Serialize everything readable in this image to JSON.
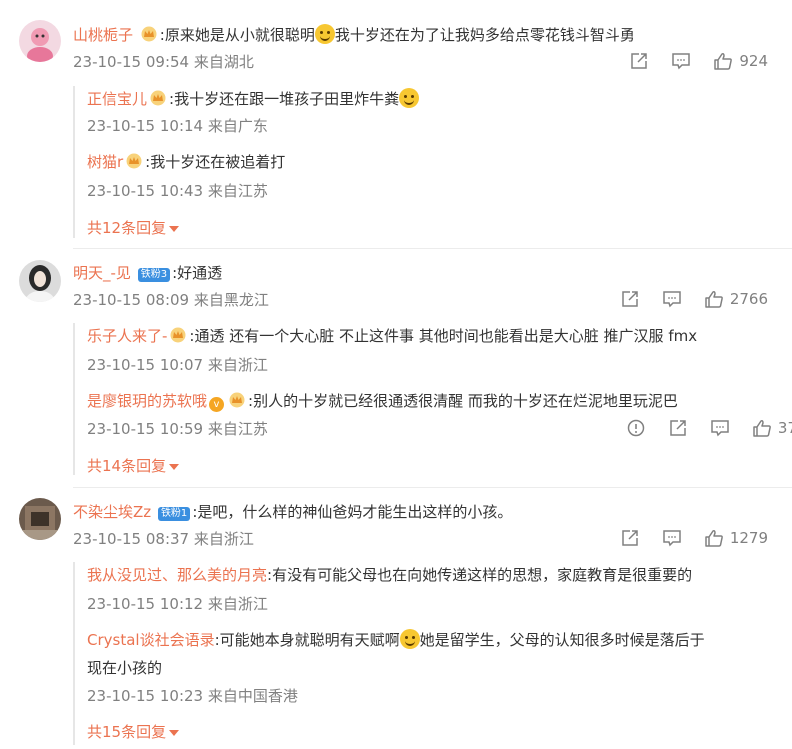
{
  "comments": [
    {
      "user": "山桃栀子",
      "text_a": ":原来她是从小就很聪明",
      "text_b": "我十岁还在为了让我妈多给点零花钱斗智斗勇",
      "time": "23-10-15 09:54 来自湖北",
      "likes": "924",
      "replies": [
        {
          "user": "正信宝儿",
          "text": ":我十岁还在跟一堆孩子田里炸牛粪",
          "time": "23-10-15 10:14 来自广东"
        },
        {
          "user": "树猫r",
          "text": ":我十岁还在被追着打",
          "time": "23-10-15 10:43 来自江苏"
        }
      ],
      "more": "共12条回复"
    },
    {
      "user": "明天_-见",
      "badge": "铁粉3",
      "text_a": ":好通透",
      "time": "23-10-15 08:09 来自黑龙江",
      "likes": "2766",
      "replies": [
        {
          "user": "乐子人来了-",
          "text": ":通透 还有一个大心脏  不止这件事 其他时间也能看出是大心脏 推广汉服  fmx",
          "time": "23-10-15 10:07 来自浙江"
        },
        {
          "user": "是廖银玥的苏软哦",
          "text": ":别人的十岁就已经很通透很清醒 而我的十岁还在烂泥地里玩泥巴",
          "time": "23-10-15 10:59 来自江苏",
          "likes": "37"
        }
      ],
      "more": "共14条回复"
    },
    {
      "user": "不染尘埃Zz",
      "badge": "铁粉1",
      "text_a": ":是吧，什么样的神仙爸妈才能生出这样的小孩。",
      "time": "23-10-15 08:37 来自浙江",
      "likes": "1279",
      "replies": [
        {
          "user": "我从没见过、那么美的月亮",
          "text": ":有没有可能父母也在向她传递这样的思想，家庭教育是很重要的",
          "time": "23-10-15 10:12 来自浙江"
        },
        {
          "user": "Crystal谈社会语录",
          "text": ":可能她本身就聪明有天赋啊",
          "text_b": "她是留学生，父母的认知很多时候是落后于",
          "text_c": "现在小孩的",
          "time": "23-10-15 10:23 来自中国香港"
        }
      ],
      "more": "共15条回复"
    }
  ],
  "colors": {
    "username": "#eb7350",
    "meta": "#808080",
    "text": "#333333",
    "fan_badge": "#3a8fe0"
  },
  "icons": [
    "share-icon",
    "comment-icon",
    "like-icon",
    "report-icon",
    "crown-icon"
  ]
}
